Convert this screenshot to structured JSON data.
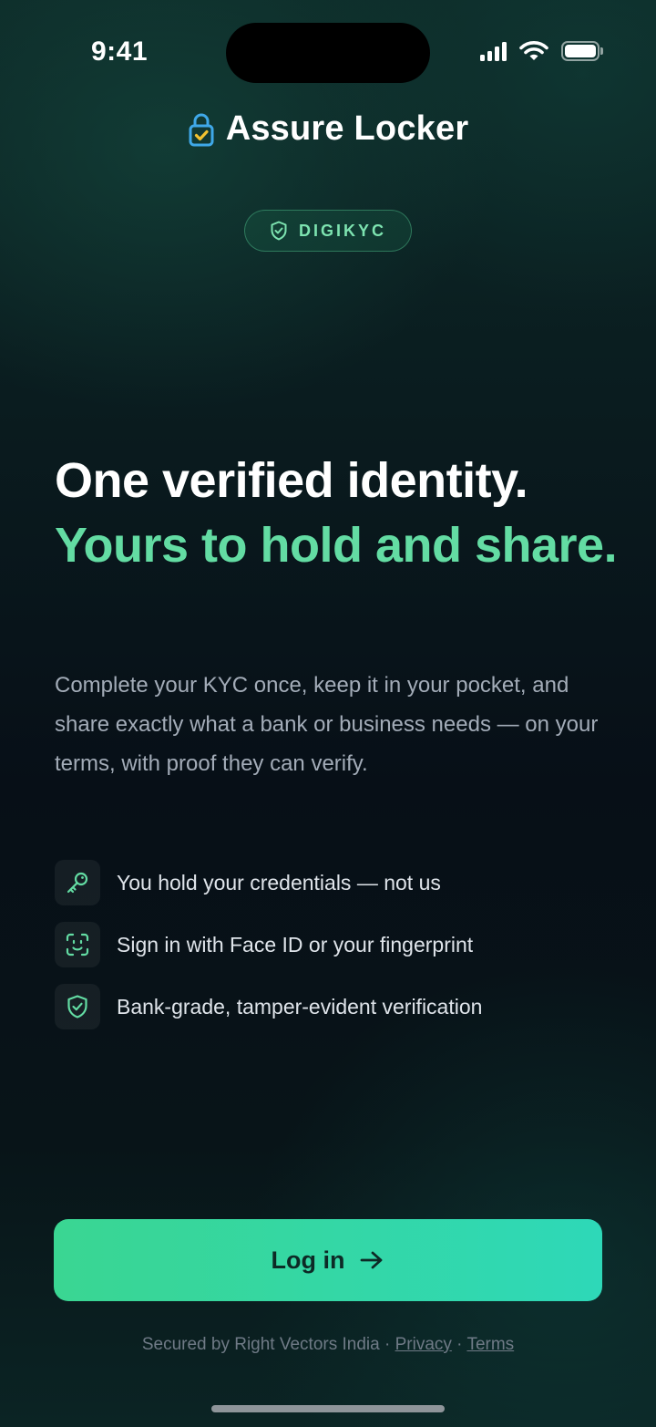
{
  "status_bar": {
    "time": "9:41"
  },
  "brand": {
    "name": "Assure Locker",
    "logo_icon": "lock-check-icon"
  },
  "badge": {
    "label": "DIGIKYC",
    "icon": "shield-check-icon"
  },
  "hero": {
    "headline_line1": "One verified identity.",
    "headline_line2": "Yours to hold and share.",
    "description": "Complete your KYC once, keep it in your pocket, and share exactly what a bank or business needs — on your terms, with proof they can verify."
  },
  "features": [
    {
      "icon": "key-icon",
      "text": "You hold your credentials — not us"
    },
    {
      "icon": "face-id-icon",
      "text": "Sign in with Face ID or your fingerprint"
    },
    {
      "icon": "shield-check-icon",
      "text": "Bank-grade, tamper-evident verification"
    }
  ],
  "login_button": {
    "label": "Log in",
    "icon": "arrow-right-icon"
  },
  "footer": {
    "secured_by": "Secured by Right Vectors India",
    "separator": "·",
    "privacy": "Privacy",
    "terms": "Terms"
  },
  "colors": {
    "accent": "#63dca3",
    "button_start": "#3ad692",
    "button_end": "#2ed8b8",
    "background": "#0b1416",
    "logo_lock": "#3fa8e8",
    "logo_check": "#f2c230"
  }
}
